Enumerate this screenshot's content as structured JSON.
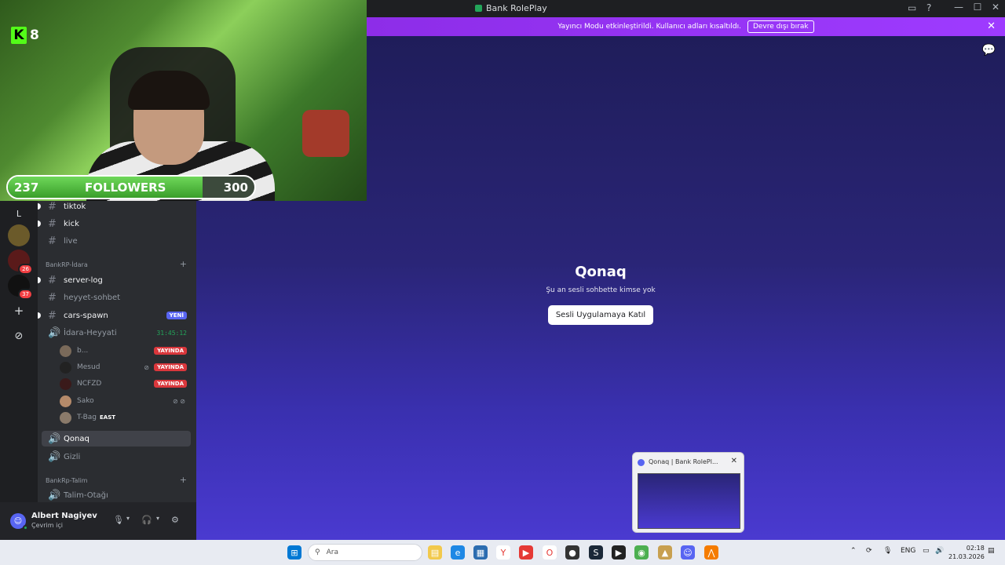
{
  "window": {
    "title": "Bank RolePlay",
    "controls": [
      "—",
      "☐",
      "✕"
    ]
  },
  "banner": {
    "text": "Yayıncı Modu etkinleştirildi. Kullanıcı adları kısaltıldı.",
    "button": "Devre dışı bırak",
    "close": "✕"
  },
  "voice": {
    "title": "Qonaq",
    "subtitle": "Şu an sesli sohbette kimse yok",
    "join_button": "Sesli Uygulamaya Katıl"
  },
  "webcam": {
    "kick_count": "8",
    "followers_current": "237",
    "followers_label": "FOLLOWERS",
    "followers_goal": "300",
    "followers_progress": 0.79
  },
  "rail": {
    "letter": "L",
    "badge_1": "26",
    "badge_2": "37"
  },
  "channels": {
    "tiktok": "tiktok",
    "kick": "kick",
    "live": "live",
    "cat_idara": "BankRP-İdara",
    "server_log": "server-log",
    "heyyet_sohbet": "heyyet-sohbet",
    "cars_spawn": "cars-spawn",
    "new_tag": "YENİ",
    "idara_heyyati": "İdara-Heyyati",
    "timer": "31:45:12",
    "qonaq": "Qonaq",
    "gizli": "Gizli",
    "cat_talim": "BankRp-Talim",
    "talim_otagi": "Talim-Otağı"
  },
  "voice_users": [
    {
      "name": "b...",
      "live": "YAYINDA"
    },
    {
      "name": "Mesud",
      "live": "YAYINDA"
    },
    {
      "name": "NCFZD",
      "live": "YAYINDA"
    },
    {
      "name": "Sako",
      "live": ""
    },
    {
      "name": "T-Bag",
      "live": "",
      "tag": "EAST"
    }
  ],
  "user_panel": {
    "name": "Albert Nagiyev",
    "status": "Çevrim içi"
  },
  "taskbar": {
    "search_placeholder": "Ara",
    "lang": "ENG",
    "time": "02:18",
    "date": "21.03.2026"
  },
  "thumbnail": {
    "title": "Qonaq | Bank RolePl..."
  },
  "colors": {
    "accent": "#5865f2",
    "banner": "#9b30ff",
    "live": "#da373c",
    "online": "#23a55a"
  }
}
